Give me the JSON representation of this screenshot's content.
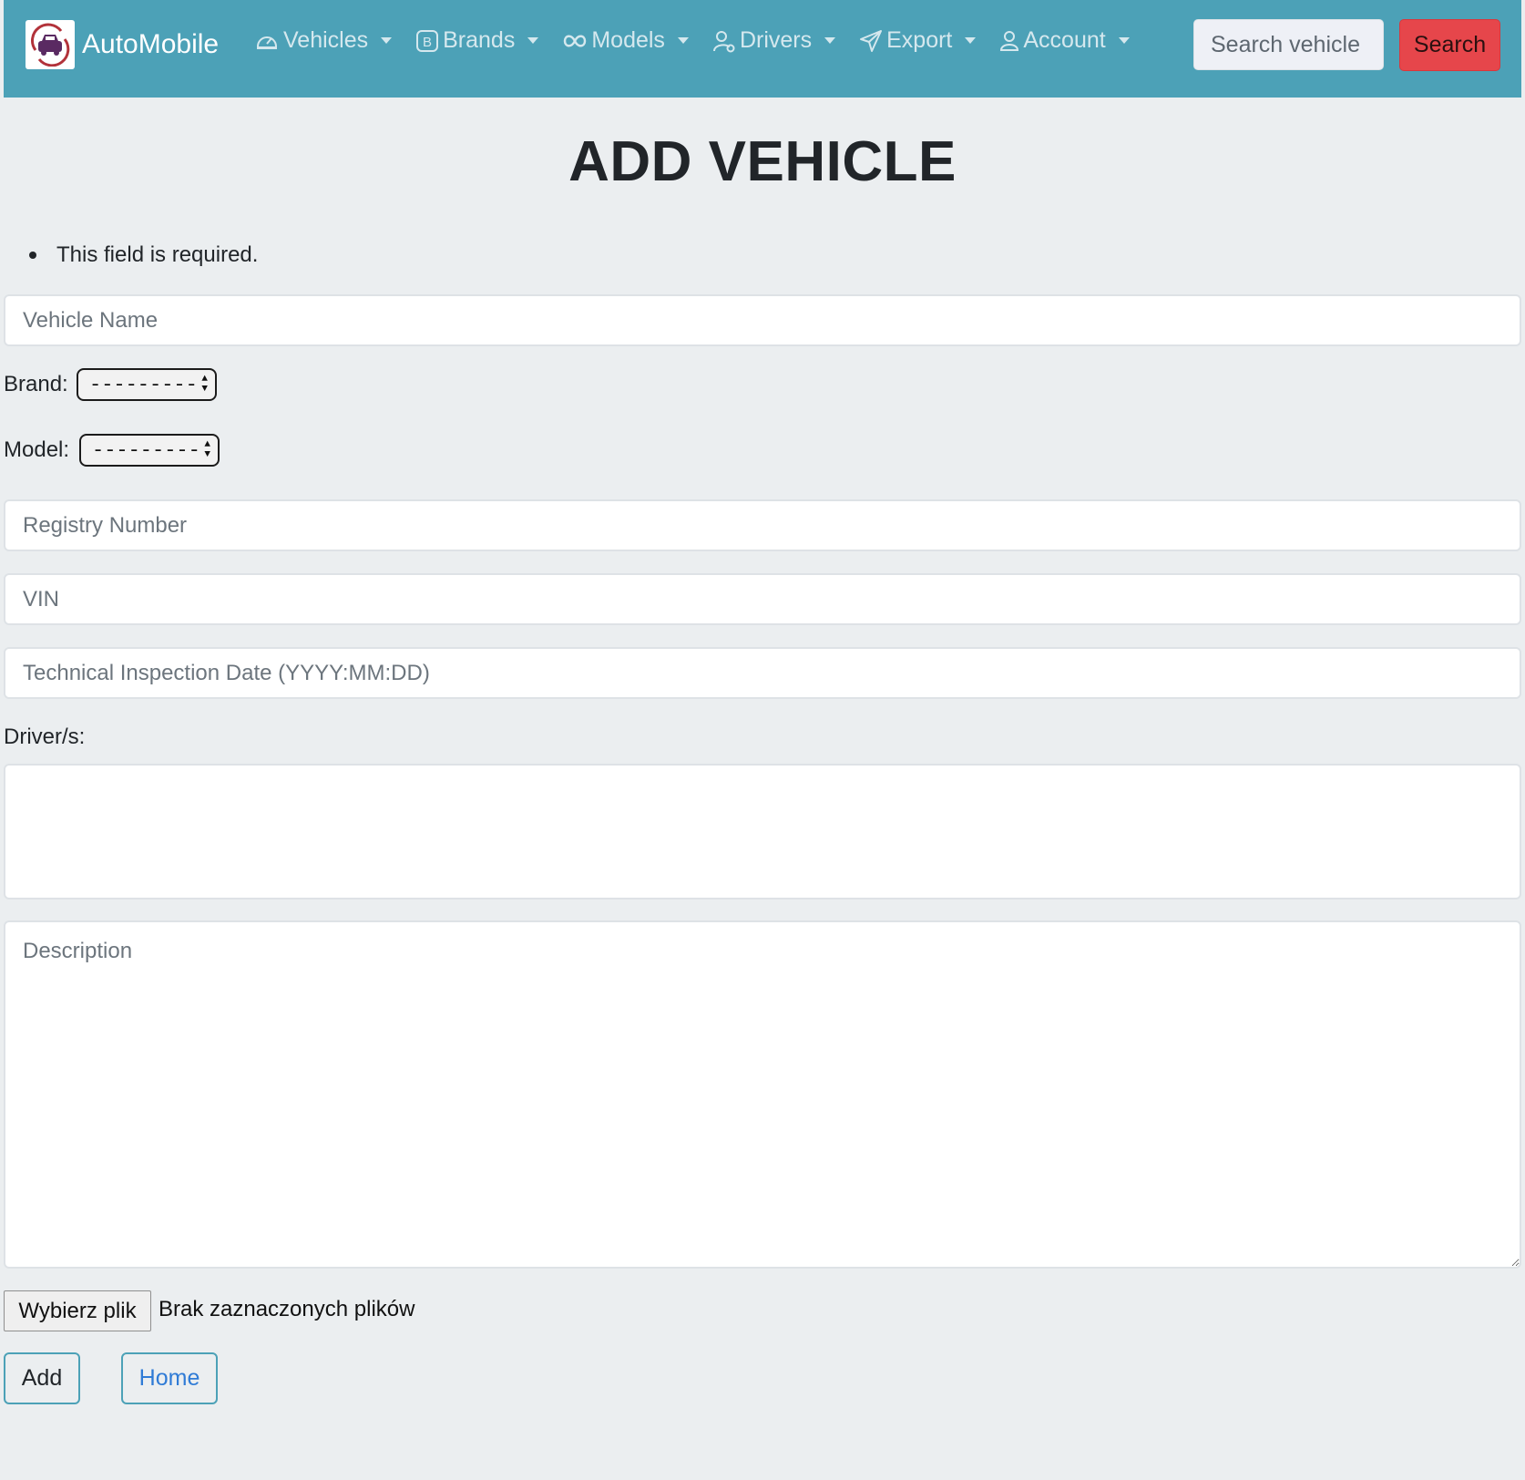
{
  "navbar": {
    "brand": "AutoMobile",
    "items": [
      {
        "label": "Vehicles",
        "icon": "car-icon"
      },
      {
        "label": "Brands",
        "icon": "brand-b-icon"
      },
      {
        "label": "Models",
        "icon": "infinity-icon"
      },
      {
        "label": "Drivers",
        "icon": "driver-gear-icon"
      },
      {
        "label": "Export",
        "icon": "send-icon"
      },
      {
        "label": "Account",
        "icon": "person-icon"
      }
    ],
    "search_placeholder": "Search vehicle",
    "search_button": "Search",
    "colors": {
      "bar": "#4ca1b7",
      "search_button": "#e6464b"
    }
  },
  "title": "ADD VEHICLE",
  "errors": [
    "This field is required."
  ],
  "form": {
    "vehicle_name_placeholder": "Vehicle Name",
    "brand_label": "Brand:",
    "brand_value": "---------",
    "model_label": "Model:",
    "model_value": "---------",
    "registry_placeholder": "Registry Number",
    "vin_placeholder": "VIN",
    "inspection_placeholder": "Technical Inspection Date (YYYY:MM:DD)",
    "drivers_label": "Driver/s:",
    "description_placeholder": "Description",
    "file_button": "Wybierz plik",
    "file_status": "Brak zaznaczonych plików",
    "add_button": "Add",
    "home_button": "Home"
  }
}
